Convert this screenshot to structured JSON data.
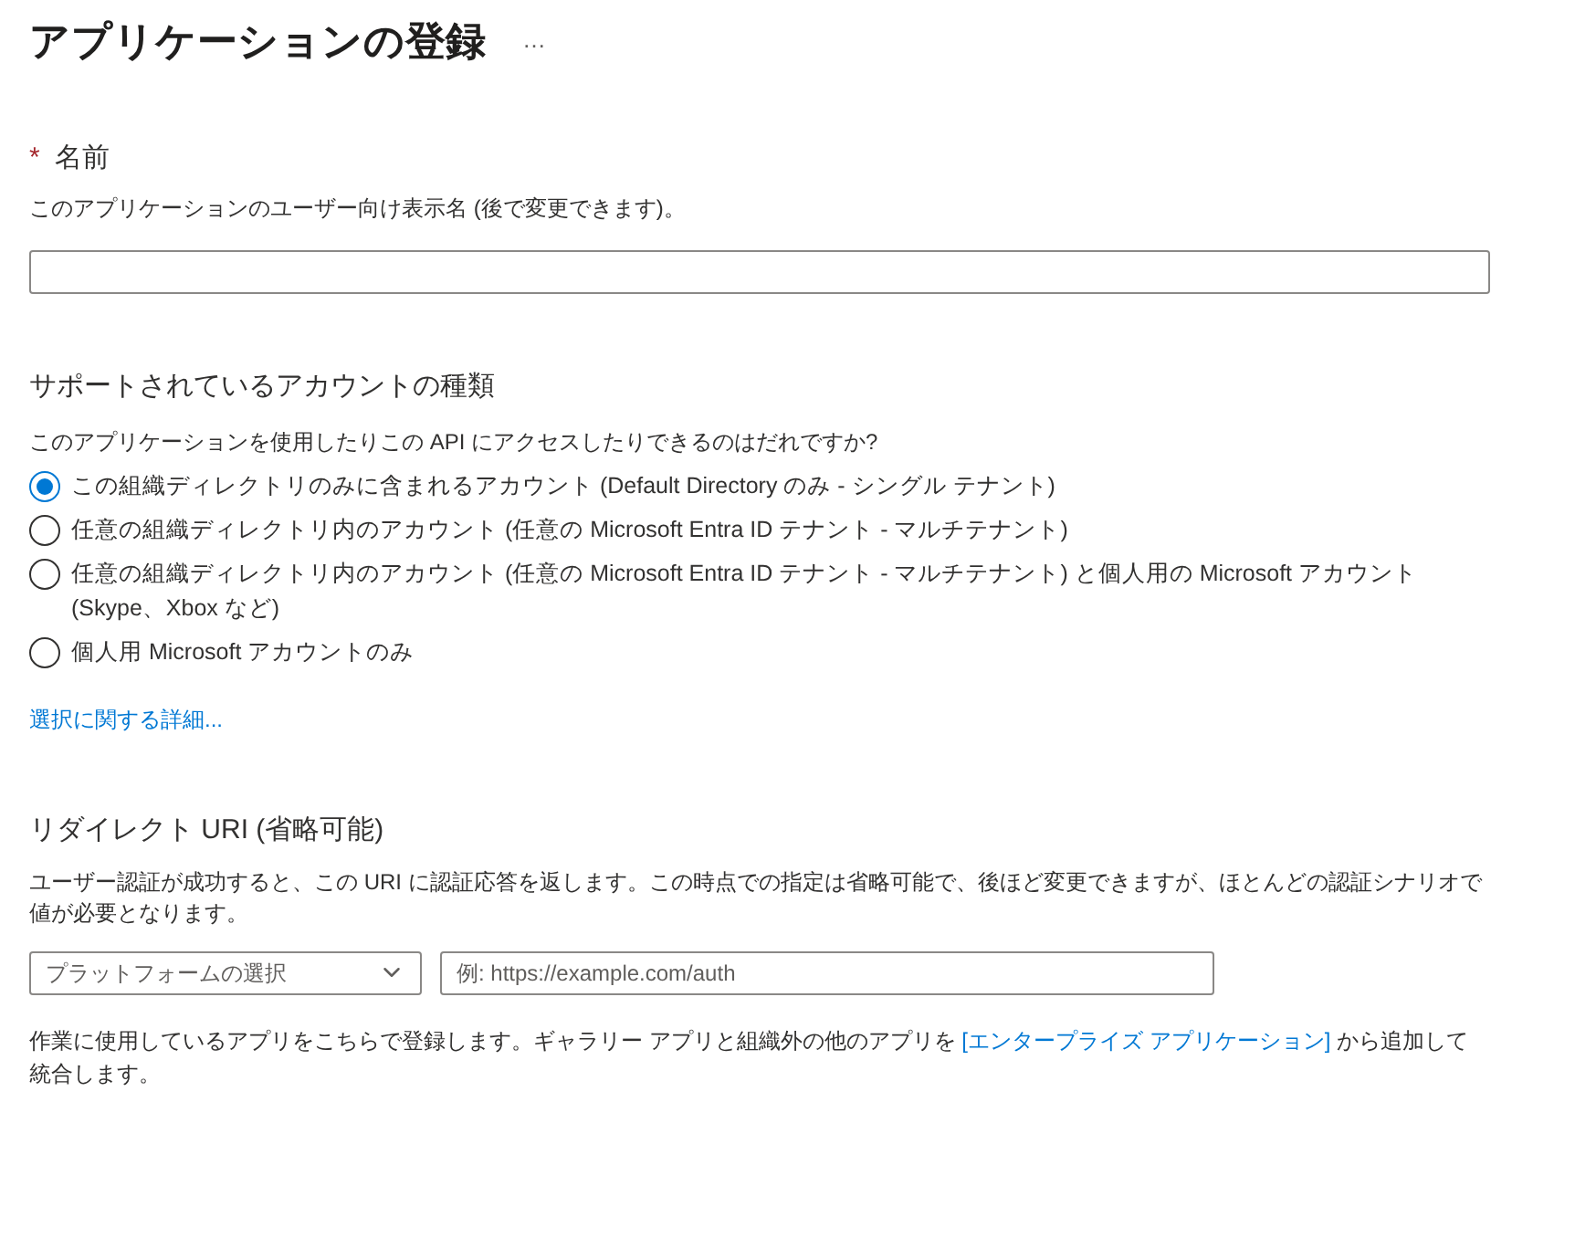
{
  "title": "アプリケーションの登録",
  "more": "…",
  "name_field": {
    "label": "名前",
    "required_mark": "*",
    "description": "このアプリケーションのユーザー向け表示名 (後で変更できます)。"
  },
  "account_types": {
    "heading": "サポートされているアカウントの種類",
    "question": "このアプリケーションを使用したりこの API にアクセスしたりできるのはだれですか?",
    "options": [
      {
        "label": "この組織ディレクトリのみに含まれるアカウント (Default Directory のみ - シングル テナント)",
        "selected": true
      },
      {
        "label": "任意の組織ディレクトリ内のアカウント (任意の Microsoft Entra ID テナント - マルチテナント)",
        "selected": false
      },
      {
        "label": "任意の組織ディレクトリ内のアカウント (任意の Microsoft Entra ID テナント - マルチテナント) と個人用の Microsoft アカウント (Skype、Xbox など)",
        "selected": false
      },
      {
        "label": "個人用 Microsoft アカウントのみ",
        "selected": false
      }
    ],
    "help_link": "選択に関する詳細..."
  },
  "redirect": {
    "heading": "リダイレクト URI (省略可能)",
    "description": "ユーザー認証が成功すると、この URI に認証応答を返します。この時点での指定は省略可能で、後ほど変更できますが、ほとんどの認証シナリオで値が必要となります。",
    "platform_select": "プラットフォームの選択",
    "uri_placeholder": "例: https://example.com/auth"
  },
  "footer": {
    "before": "作業に使用しているアプリをこちらで登録します。ギャラリー アプリと組織外の他のアプリを ",
    "link": "[エンタープライズ アプリケーション]",
    "after": " から追加して統合します。"
  }
}
